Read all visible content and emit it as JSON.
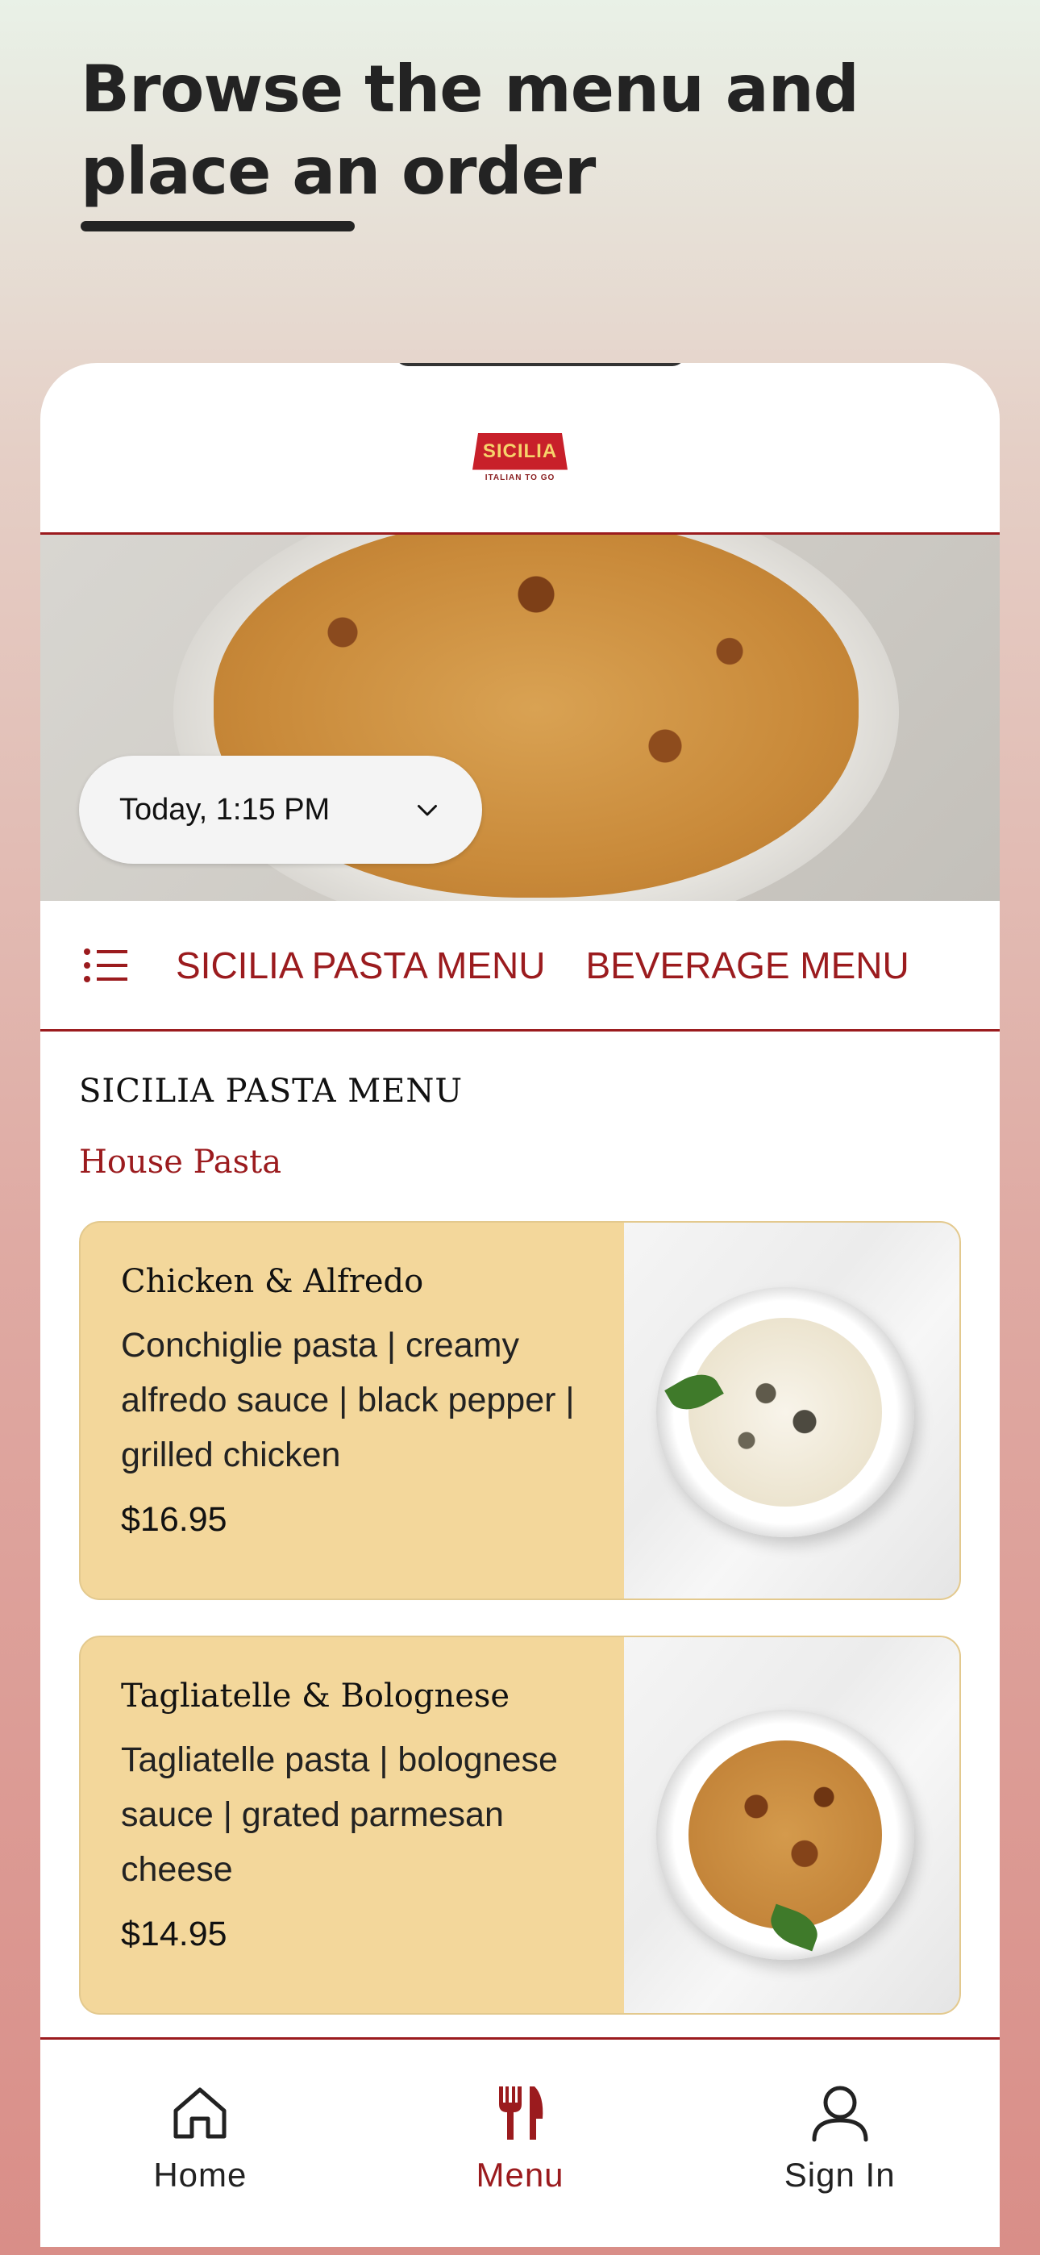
{
  "promo": {
    "title_line1": "Browse the menu and",
    "title_line2": "place an order"
  },
  "app": {
    "logo_text": "SICILIA",
    "logo_subtext": "ITALIAN TO GO",
    "time_picker_value": "Today, 1:15 PM",
    "tabs": [
      {
        "label": "SICILIA PASTA MENU"
      },
      {
        "label": "BEVERAGE MENU"
      }
    ],
    "section_title": "SICILIA PASTA MENU",
    "category": "House Pasta",
    "items": [
      {
        "name": "Chicken & Alfredo",
        "description": "Conchiglie pasta | creamy alfredo sauce | black pepper | grilled chicken",
        "price": "$16.95"
      },
      {
        "name": "Tagliatelle & Bolognese",
        "description": "Tagliatelle pasta | bolognese sauce | grated parmesan cheese",
        "price": "$14.95"
      }
    ],
    "bottom_nav": [
      {
        "label": "Home",
        "icon": "home-icon"
      },
      {
        "label": "Menu",
        "icon": "fork-knife-icon"
      },
      {
        "label": "Sign In",
        "icon": "user-icon"
      }
    ]
  },
  "colors": {
    "accent": "#9b1b1e",
    "card_bg": "#f3d79b",
    "logo_red": "#c8202a",
    "logo_yellow": "#f6d36b"
  }
}
